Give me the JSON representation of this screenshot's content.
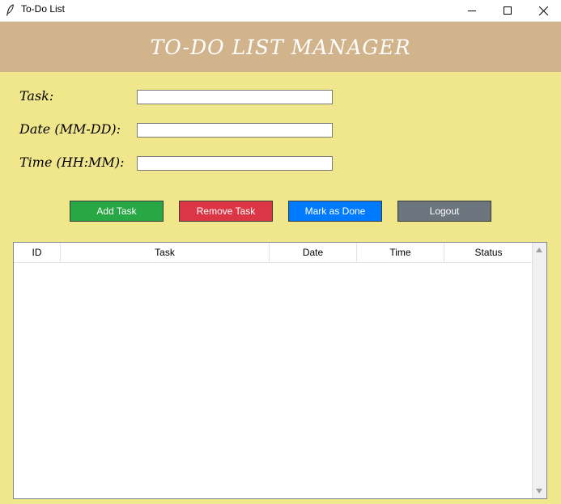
{
  "window": {
    "title": "To-Do List",
    "app_icon": "feather-icon",
    "controls": [
      "minimize-icon",
      "maximize-icon",
      "close-icon"
    ]
  },
  "header": {
    "title": "TO-DO LIST MANAGER"
  },
  "form": {
    "task_label": "Task:",
    "task_value": "",
    "date_label": "Date (MM-DD):",
    "date_value": "",
    "time_label": "Time (HH:MM):",
    "time_value": ""
  },
  "buttons": {
    "add": "Add Task",
    "remove": "Remove Task",
    "done": "Mark as Done",
    "logout": "Logout"
  },
  "table": {
    "columns": [
      "ID",
      "Task",
      "Date",
      "Time",
      "Status"
    ],
    "rows": []
  },
  "colors": {
    "background": "#F0E68C",
    "header": "#D2B48C",
    "add": "#28A745",
    "remove": "#DC3545",
    "done": "#007BFF",
    "logout": "#6C757D"
  }
}
